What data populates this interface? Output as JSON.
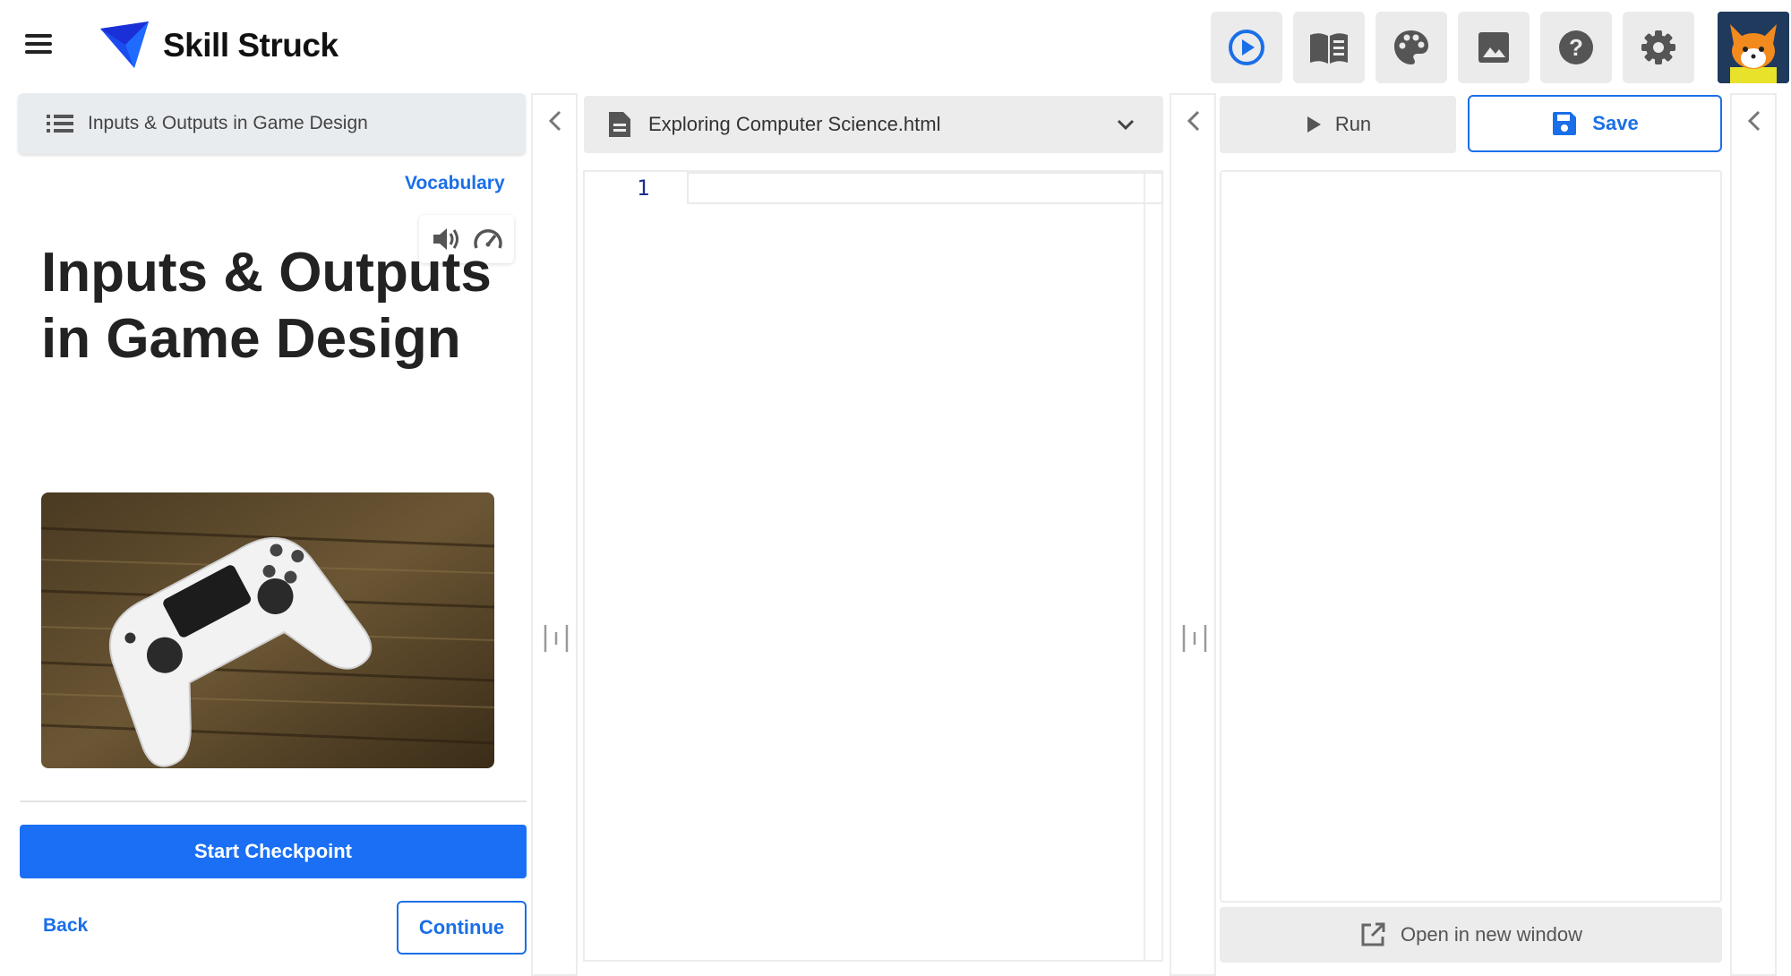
{
  "header": {
    "brand": "Skill Struck",
    "tools": [
      {
        "name": "play-icon"
      },
      {
        "name": "book-icon"
      },
      {
        "name": "palette-icon"
      },
      {
        "name": "image-icon"
      },
      {
        "name": "help-icon"
      },
      {
        "name": "gear-icon"
      }
    ],
    "accent_color": "#1a6fe8"
  },
  "lesson": {
    "bar_label": "Inputs & Outputs in Game Design",
    "vocabulary_label": "Vocabulary",
    "title": "Inputs & Outputs in Game Design",
    "checkpoint_label": "Start Checkpoint",
    "back_label": "Back",
    "continue_label": "Continue"
  },
  "editor": {
    "file_name": "Exploring Computer Science.html",
    "line_numbers": [
      "1"
    ]
  },
  "preview": {
    "run_label": "Run",
    "save_label": "Save",
    "open_label": "Open in new window"
  }
}
